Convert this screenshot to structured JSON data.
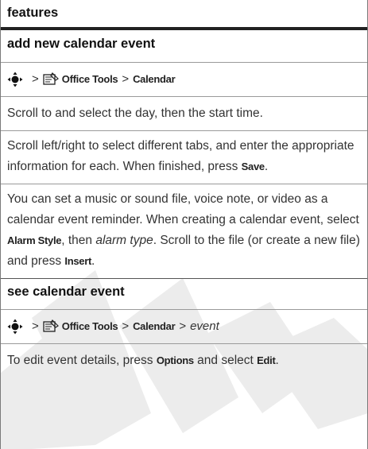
{
  "header": {
    "title": "features"
  },
  "sections": [
    {
      "title": "add new calendar event",
      "path": {
        "sep1": ">",
        "office_tools": "Office Tools",
        "sep2": ">",
        "calendar": "Calendar"
      },
      "p1": "Scroll to and select the day, then the start time.",
      "p2_before": "Scroll left/right to select different tabs, and enter the appropriate information for each. When finished, press ",
      "p2_save": "Save",
      "p2_after": ".",
      "p3_before": "You can set a music or sound file, voice note, or video as a calendar event reminder. When creating a calendar event, select ",
      "p3_alarm_style": "Alarm Style",
      "p3_mid": ", then ",
      "p3_alarm_type": "alarm type",
      "p3_mid2": ". Scroll to the file (or create a new file) and press ",
      "p3_insert": "Insert",
      "p3_after": "."
    },
    {
      "title": "see calendar event",
      "path": {
        "sep1": ">",
        "office_tools": "Office Tools",
        "sep2": ">",
        "calendar": "Calendar",
        "sep3": ">",
        "event": "event"
      },
      "p1_before": "To edit event details, press ",
      "p1_options": "Options",
      "p1_mid": " and select ",
      "p1_edit": "Edit",
      "p1_after": "."
    }
  ],
  "icons": {
    "nav": "nav-key-icon",
    "office": "office-tools-icon"
  },
  "colors": {
    "watermark": "#ececec",
    "header_rule": "#222222"
  }
}
